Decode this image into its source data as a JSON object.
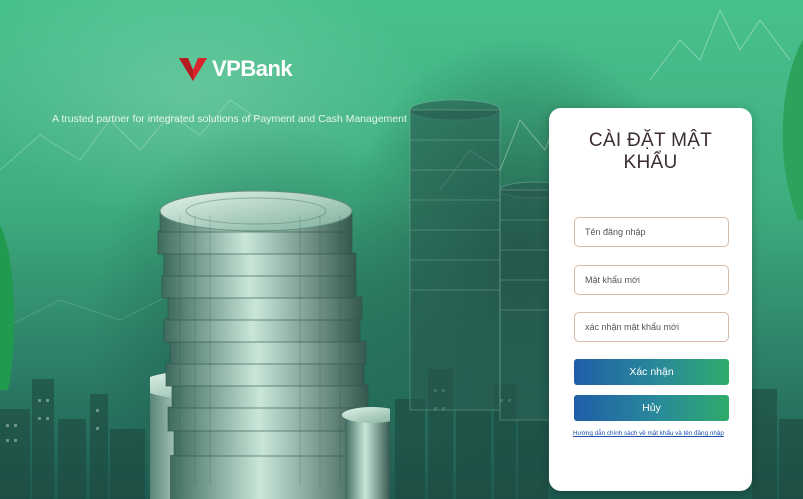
{
  "brand": {
    "name": "VPBank",
    "tagline": "A trusted partner for integrated solutions of Payment and Cash Management"
  },
  "colors": {
    "brand_red": "#d8242a",
    "background_green": "#3fae7f",
    "button_gradient_start": "#1f5ea8",
    "button_gradient_end": "#2eab6a",
    "link_blue": "#1a4fb0"
  },
  "form": {
    "title_line1": "CÀI ĐẶT MẬT",
    "title_line2": "KHẨU",
    "username_placeholder": "Tên đăng nhập",
    "new_password_placeholder": "Mật khẩu mới",
    "confirm_password_placeholder": "xác nhận mật khẩu mới",
    "confirm_button": "Xác nhận",
    "cancel_button": "Hủy",
    "help_link": "Hướng dẫn chính sách về mật khẩu và tên đăng nhập"
  }
}
